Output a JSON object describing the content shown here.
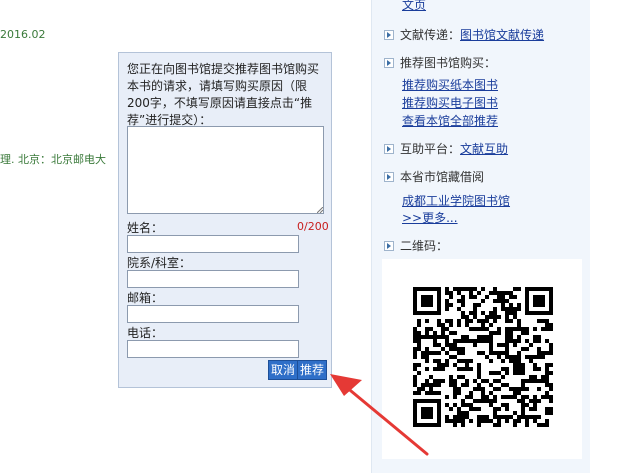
{
  "background": {
    "date_fragment": "2016.02",
    "publisher_fragment": "理. 北京：北京邮电大"
  },
  "right_panel": {
    "top_link": "文页",
    "delivery_label": "文献传递：",
    "delivery_link": "图书馆文献传递",
    "recommend_heading": "推荐图书馆购买：",
    "recommend_links": [
      "推荐购买纸本图书",
      "推荐购买电子图书",
      "查看本馆全部推荐"
    ],
    "mutual_label": "互助平台：",
    "mutual_link": "文献互助",
    "local_heading": "本省市馆藏借阅",
    "local_links": [
      "成都工业学院图书馆",
      ">>更多..."
    ],
    "qr_label": "二维码："
  },
  "popup": {
    "intro_text": "您正在向图书馆提交推荐图书馆购买本书的请求，请填写购买原因（限200字，不填写原因请直接点击“推荐”进行提交）：",
    "reason_value": "",
    "char_counter": "0/200",
    "name_label": "姓名：",
    "dept_label": "院系/科室：",
    "email_label": "邮箱：",
    "phone_label": "电话：",
    "cancel_label": "取消",
    "submit_label": "推荐"
  },
  "colors": {
    "accent": "#2f6fc8",
    "link": "#1a3d9b",
    "counter": "#c81e1e",
    "arrow": "#e53935",
    "popup_bg": "#e8eef8"
  }
}
